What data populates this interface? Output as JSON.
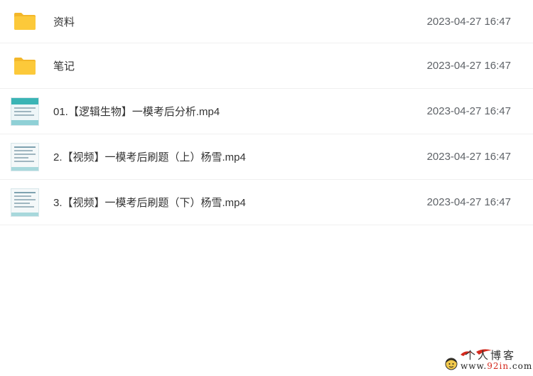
{
  "files": [
    {
      "name": "资料",
      "date": "2023-04-27 16:47",
      "icon": "folder-icon"
    },
    {
      "name": "笔记",
      "date": "2023-04-27 16:47",
      "icon": "folder-icon"
    },
    {
      "name": "01.【逻辑生物】一模考后分析.mp4",
      "date": "2023-04-27 16:47",
      "icon": "video-thumbnail-icon"
    },
    {
      "name": "2.【视频】一模考后刷题（上）杨雪.mp4",
      "date": "2023-04-27 16:47",
      "icon": "video-thumbnail-icon"
    },
    {
      "name": "3.【视频】一模考后刷题（下）杨雪.mp4",
      "date": "2023-04-27 16:47",
      "icon": "video-thumbnail-icon"
    }
  ],
  "watermark": {
    "title": "个人博客",
    "url_prefix": "www.",
    "url_highlight": "92in",
    "url_suffix": ".com"
  },
  "colors": {
    "folder": "#fcc93a",
    "folder_dark": "#f3b72a",
    "thumb_accent": "#3ab4b5",
    "date_text": "#5f6368",
    "watermark_red": "#d42a1e"
  }
}
